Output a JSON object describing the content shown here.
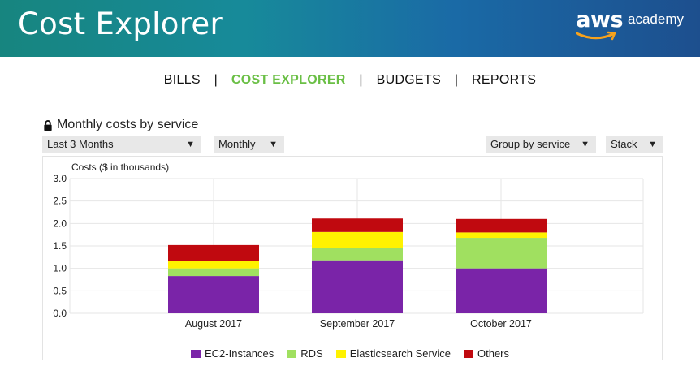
{
  "banner": {
    "title": "Cost Explorer",
    "logo_aws": "aws",
    "logo_academy": "academy"
  },
  "nav": {
    "bills": "BILLS",
    "cost_explorer": "COST EXPLORER",
    "budgets": "BUDGETS",
    "reports": "REPORTS",
    "separator": "|"
  },
  "section": {
    "title": "Monthly costs by service",
    "icon": "lock-icon"
  },
  "controls": {
    "range": "Last 3 Months",
    "granularity": "Monthly",
    "group_by": "Group by service",
    "chart_style": "Stack",
    "caret": "▼"
  },
  "chart_data": {
    "type": "bar",
    "stacked": true,
    "ylabel": "Costs ($ in thousands)",
    "ylim": [
      0,
      3.0
    ],
    "yticks": [
      "0.0",
      "0.5",
      "1.0",
      "1.5",
      "2.0",
      "2.5",
      "3.0"
    ],
    "categories": [
      "August 2017",
      "September 2017",
      "October 2017"
    ],
    "series": [
      {
        "name": "EC2-Instances",
        "color": "#7a24a8",
        "values": [
          0.83,
          1.18,
          1.0
        ]
      },
      {
        "name": "RDS",
        "color": "#a0e060",
        "values": [
          0.17,
          0.28,
          0.68
        ]
      },
      {
        "name": "Elasticsearch Service",
        "color": "#fff200",
        "values": [
          0.17,
          0.35,
          0.12
        ]
      },
      {
        "name": "Others",
        "color": "#c0090f",
        "values": [
          0.35,
          0.3,
          0.3
        ]
      }
    ],
    "legend_position": "bottom",
    "grid": true
  }
}
